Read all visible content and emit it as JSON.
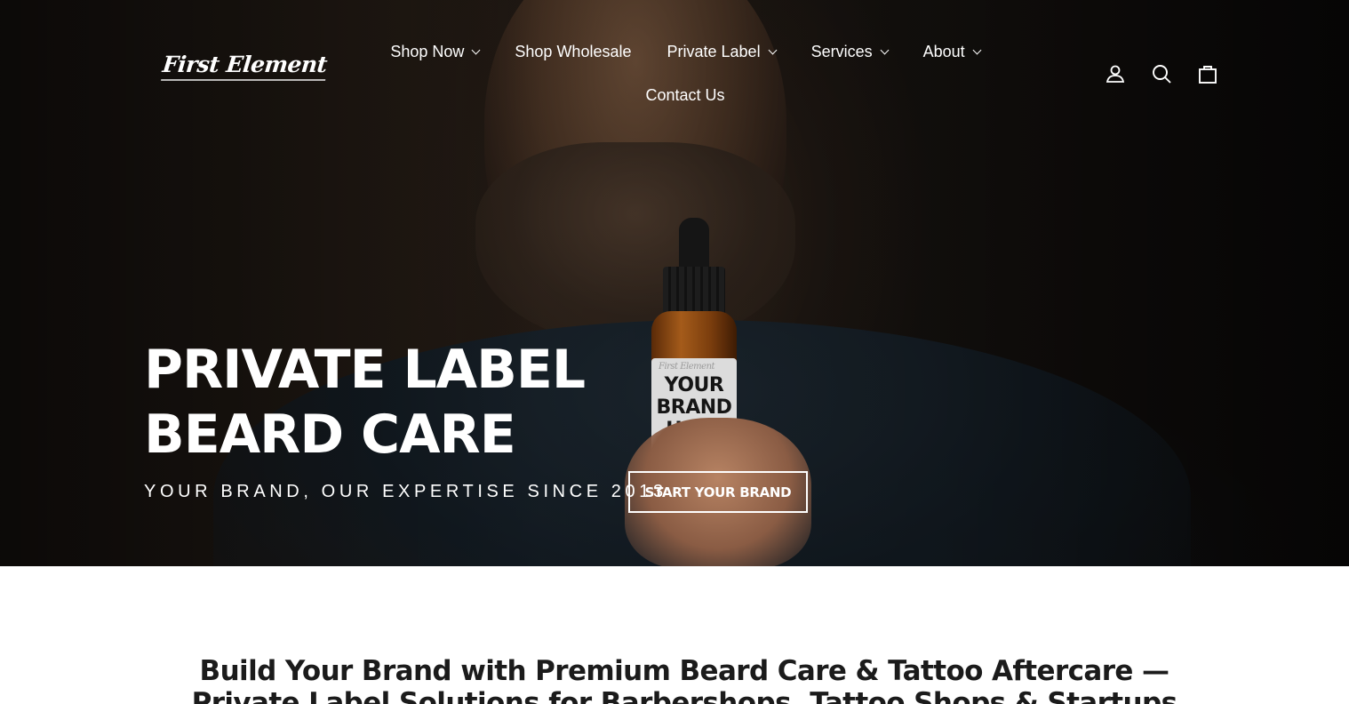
{
  "header": {
    "logo_text": "First Element",
    "nav": [
      {
        "label": "Shop Now",
        "has_dropdown": true
      },
      {
        "label": "Shop Wholesale",
        "has_dropdown": false
      },
      {
        "label": "Private Label",
        "has_dropdown": true
      },
      {
        "label": "Services",
        "has_dropdown": true
      },
      {
        "label": "About",
        "has_dropdown": true
      },
      {
        "label": "Contact Us",
        "has_dropdown": false
      }
    ],
    "icons": [
      "account-icon",
      "search-icon",
      "cart-icon"
    ]
  },
  "hero": {
    "title_line1": "PRIVATE LABEL",
    "title_line2": "BEARD CARE",
    "subtitle": "YOUR BRAND, OUR EXPERTISE SINCE 2013",
    "cta_label": "START YOUR BRAND",
    "bottle_label": {
      "brand": "First Element",
      "line1": "YOUR",
      "line2": "BRAND",
      "line3": "HERE"
    }
  },
  "intro": {
    "heading": "Build Your Brand with Premium Beard Care & Tattoo Aftercare — Private Label Solutions for Barbershops, Tattoo Shops & Startups"
  },
  "colors": {
    "hero_text": "#ffffff",
    "heading_text": "#1b1b1b",
    "page_bg": "#ffffff"
  }
}
